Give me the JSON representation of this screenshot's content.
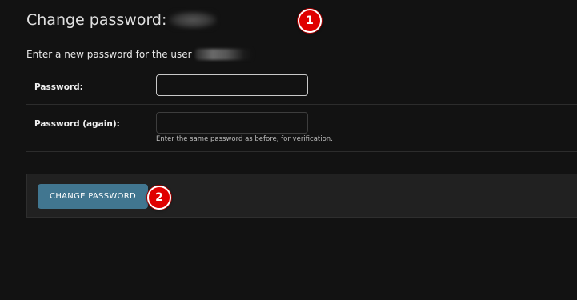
{
  "page": {
    "title": "Change password:",
    "intro": "Enter a new password for the user"
  },
  "form": {
    "password_label": "Password:",
    "password_value": "",
    "password_again_label": "Password (again):",
    "password_again_value": "",
    "password_again_help": "Enter the same password as before, for verification.",
    "submit_label": "CHANGE PASSWORD"
  },
  "annotations": {
    "badge_1": "1",
    "badge_2": "2"
  },
  "colors": {
    "background": "#121212",
    "submit_row": "#212121",
    "button": "#417690",
    "badge": "#e00000"
  }
}
